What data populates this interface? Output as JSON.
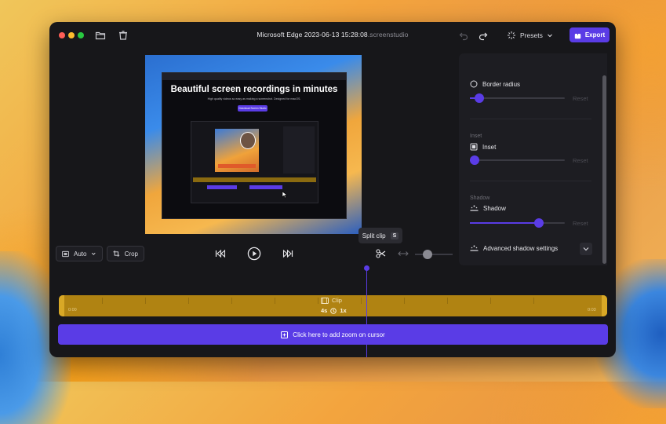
{
  "window": {
    "title_main": "Microsoft Edge 2023-06-13 15:28:08",
    "title_ext": ".screenstudio"
  },
  "toolbar": {
    "presets_label": "Presets",
    "export_label": "Export"
  },
  "preview": {
    "headline": "Beautiful screen recordings in minutes",
    "subtitle": "High quality videos so easy as making a screenshot. Designed for macOS.",
    "button_label": "Download Screen Studio"
  },
  "controls": {
    "aspect_label": "Auto",
    "crop_label": "Crop"
  },
  "tooltip": {
    "label": "Split clip",
    "shortcut": "S"
  },
  "panel": {
    "border_radius_label": "Border radius",
    "border_radius_value": 0.1,
    "inset_section": "Inset",
    "inset_label": "Inset",
    "inset_value": 0.05,
    "shadow_section": "Shadow",
    "shadow_label": "Shadow",
    "shadow_value": 0.73,
    "reset_label": "Reset",
    "advanced_shadow_label": "Advanced shadow settings"
  },
  "timeline": {
    "clip_label": "Clip",
    "clip_duration": "4s",
    "clip_speed": "1x",
    "start_time": "0:00",
    "end_time": "0:03",
    "zoom_bar_label": "Click here to add zoom on cursor"
  },
  "colors": {
    "accent": "#5a3ce6",
    "clip": "#b08312"
  }
}
